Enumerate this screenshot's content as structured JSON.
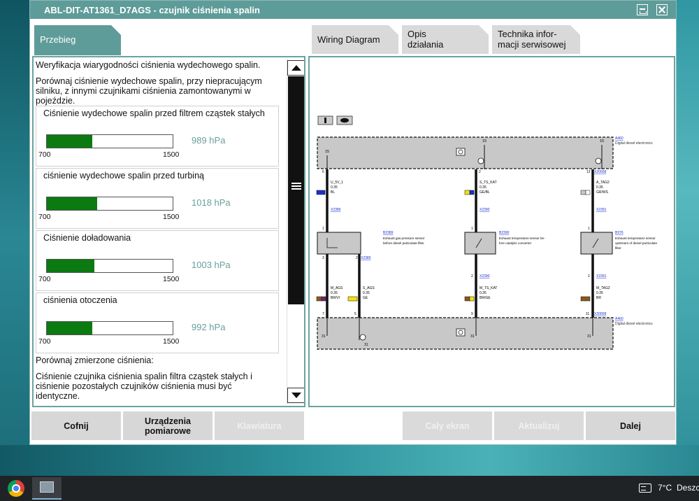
{
  "window": {
    "title": "ABL-DIT-AT1361_D7AGS  -  czujnik ciśnienia spalin"
  },
  "tabs": {
    "left": "Przebieg",
    "wiring": "Wiring Diagram",
    "opis_line1": "Opis",
    "opis_line2": "działania",
    "tech_line1": "Technika infor-",
    "tech_line2": "macji serwisowej"
  },
  "procedure": {
    "heading": "Weryfikacja wiarygodności ciśnienia wydechowego spalin.",
    "instruction": "Porównaj ciśnienie wydechowe spalin, przy niepracującym silniku, z innymi czujnikami ciśnienia zamontowanymi w pojeździe.",
    "gauges": [
      {
        "label": "Ciśnienie wydechowe spalin przed filtrem cząstek stałych",
        "min": "700",
        "max": "1500",
        "value": "989 hPa",
        "fill": 0.36
      },
      {
        "label": "ciśnienie wydechowe spalin przed turbiną",
        "min": "700",
        "max": "1500",
        "value": "1018 hPa",
        "fill": 0.4
      },
      {
        "label": "Ciśnienie doładowania",
        "min": "700",
        "max": "1500",
        "value": "1003 hPa",
        "fill": 0.38
      },
      {
        "label": "ciśnienia otoczenia",
        "min": "700",
        "max": "1500",
        "value": "992 hPa",
        "fill": 0.36
      }
    ],
    "compare_text": "Porównaj zmierzone ciśnienia:",
    "result_text": "Ciśnienie czujnika ciśnienia spalin filtra cząstek stałych i ciśnienie pozostałych czujników ciśnienia musi być identyczne."
  },
  "diagram": {
    "info_icon": "info-icon",
    "eye_icon": "eye-icon",
    "top_module_id": "A460",
    "top_module_name": "Digital diesel electronics",
    "bottom_module_id": "A460",
    "bottom_module_name": "Digital diesel electronics",
    "conn_top": [
      "X20008",
      "X20008"
    ],
    "pins_top": [
      "6",
      "2",
      "12"
    ],
    "wires_top": [
      {
        "name": "U_5V_1",
        "size": "0.35",
        "color": "BL",
        "hex": "#1a2fd1"
      },
      {
        "name": "S_TS_KAT",
        "size": "0.35",
        "color": "GE/BL",
        "hex": "#f2e20c"
      },
      {
        "name": "A_TAG2",
        "size": "0.35",
        "color": "GR/WS",
        "hex": "#c8c8c8"
      }
    ],
    "conn_mid": [
      "X2389",
      "X2390",
      "X2391"
    ],
    "pins_mid": [
      "1",
      "1",
      "1"
    ],
    "sensors": [
      {
        "id": "B2389",
        "desc1": "Exhaust gas pressure sensor",
        "desc2": "before diesel particulate filter",
        "desc3": ""
      },
      {
        "id": "B2390",
        "desc1": "Exhaust temperature sensor be-",
        "desc2": "fore catalytic converter",
        "desc3": ""
      },
      {
        "id": "B376",
        "desc1": "Exhaust temperature sensor",
        "desc2": "upstream of diesel particulate",
        "desc3": "filter"
      }
    ],
    "conn_low": [
      "X2389",
      "X2390",
      "X2391"
    ],
    "pins_low": [
      "3",
      "2",
      "2",
      "2"
    ],
    "wires_bottom": [
      {
        "name": "M_AGS",
        "size": "0.35",
        "color": "BR/VI",
        "hex": "#8a5a1c"
      },
      {
        "name": "S_AGS",
        "size": "0.35",
        "color": "GE",
        "hex": "#f2e20c"
      },
      {
        "name": "M_TS_KAT",
        "size": "0.35",
        "color": "BR/GE",
        "hex": "#8a5a1c"
      },
      {
        "name": "M_TAG2",
        "size": "0.35",
        "color": "BR",
        "hex": "#8a5a1c"
      }
    ],
    "pins_bottom": [
      "7",
      "5",
      "9",
      "11"
    ],
    "pin_15": "15",
    "pin_31": "31"
  },
  "buttons": {
    "back": "Cofnij",
    "devices_line1": "Urządzenia",
    "devices_line2": "pomiarowe",
    "keyboard": "Klawiatura",
    "fullscreen": "Cały ekran",
    "refresh": "Aktualizuj",
    "next": "Dalej"
  },
  "taskbar": {
    "temperature": "7°C",
    "weather": "Deszc"
  }
}
